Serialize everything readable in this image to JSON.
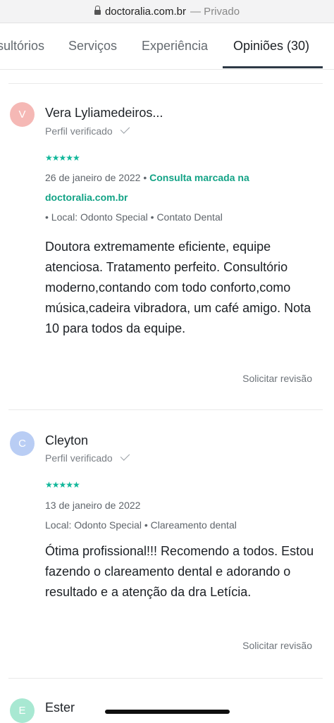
{
  "browser": {
    "domain": "doctoralia.com.br",
    "privacy": "— Privado"
  },
  "tabs": [
    {
      "label": "sultórios"
    },
    {
      "label": "Serviços"
    },
    {
      "label": "Experiência"
    },
    {
      "label": "Opiniões (30)",
      "active": true
    }
  ],
  "reviews": [
    {
      "initial": "V",
      "avatar_color": "#f5b8b5",
      "name": "Vera Lyliamedeiros...",
      "verified": "Perfil verificado",
      "stars": "★★★★★",
      "rating": 5,
      "date": "26 de janeiro de 2022",
      "booked_prefix": "•",
      "booked_line1": "Consulta marcada na",
      "booked_line2": "doctoralia.com.br",
      "location": "• Local: Odonto Special • Contato Dental",
      "text": "Doutora extremamente eficiente, equipe atenciosa. Tratamento perfeito. Consultório moderno,contando com todo conforto,como música,cadeira vibradora, um café amigo. Nota 10 para todos da equipe.",
      "revision": "Solicitar revisão"
    },
    {
      "initial": "C",
      "avatar_color": "#b9cdf4",
      "name": "Cleyton",
      "verified": "Perfil verificado",
      "stars": "★★★★★",
      "rating": 5,
      "date": "13 de janeiro de 2022",
      "location": "Local: Odonto Special • Clareamento dental",
      "text": "Ótima profissional!!! Recomendo a todos. Estou fazendo o clareamento dental e adorando o resultado e a atenção da dra Letícia.",
      "revision": "Solicitar revisão"
    },
    {
      "initial": "E",
      "avatar_color": "#a8e8d2",
      "name": "Ester"
    }
  ],
  "colors": {
    "accent_green": "#13a386",
    "star_green": "#11b79a",
    "tab_underline": "#2d3946"
  }
}
